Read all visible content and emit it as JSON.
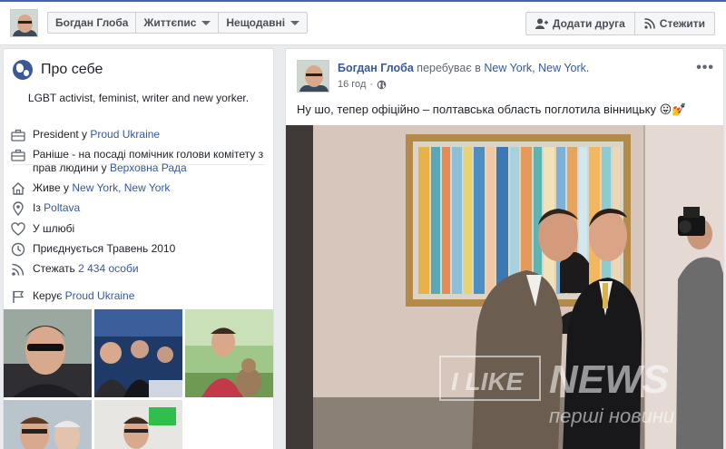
{
  "top": {
    "name": "Богдан Глоба",
    "timeline": "Життєпис",
    "recent": "Нещодавні",
    "add_friend": "Додати друга",
    "follow": "Стежити"
  },
  "intro": {
    "title": "Про себе",
    "bio": "LGBT activist, feminist, writer and new yorker.",
    "work1_prefix": "President у ",
    "work1_link": "Proud Ukraine",
    "work2_line1": "Раніше - на посаді помічник голови комітету з",
    "work2_prefix": "прав людини у ",
    "work2_link": "Верховна Рада",
    "lives_prefix": "Живе у ",
    "lives_link": "New York, New York",
    "from_prefix": "Із ",
    "from_link": "Poltava",
    "relationship": "У шлюбі",
    "joined": "Приєднується Травень 2010",
    "followers_prefix": "Стежать ",
    "followers_link": "2 434 особи",
    "manages_prefix": "Керує ",
    "manages_link": "Proud Ukraine"
  },
  "post": {
    "author": "Богдан Глоба",
    "location_prefix": "перебуває в",
    "location": "New York, New York.",
    "time": "16 год",
    "more": "•••",
    "text": "Ну шо, тепер офіційно – полтавська область поглотила вінницьку 😛💅",
    "watermark_brand": "NEWS",
    "watermark_like": "I LIKE",
    "watermark_sub": "перші новини"
  },
  "colors": {
    "accent": "#4267b2",
    "link": "#385898",
    "background": "#e9ebee"
  }
}
